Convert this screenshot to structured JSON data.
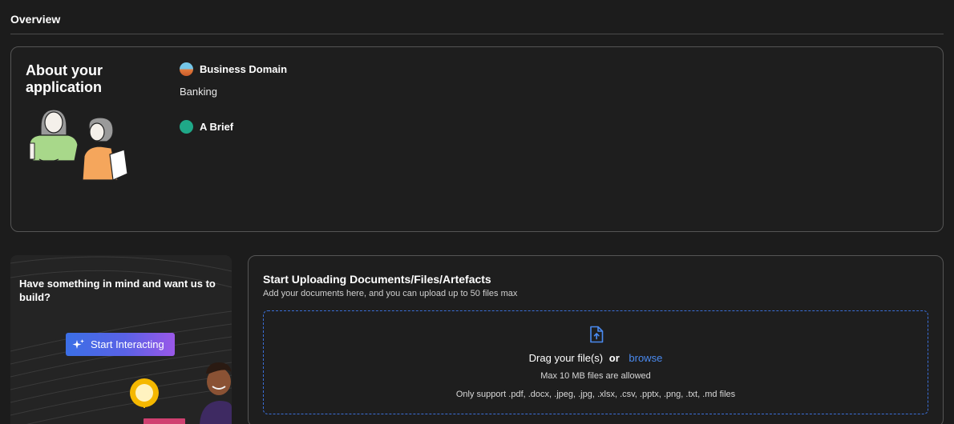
{
  "overview": {
    "title": "Overview"
  },
  "about": {
    "title": "About your application",
    "business_domain_label": "Business Domain",
    "business_domain_value": "Banking",
    "brief_label": "A Brief"
  },
  "promo": {
    "text": "Have something in mind and want us to build?",
    "button_label": "Start Interacting"
  },
  "upload": {
    "title": "Start Uploading Documents/Files/Artefacts",
    "subtitle": "Add your documents here, and you can upload up to 50 files max",
    "drag_text": "Drag your file(s)",
    "or_text": "or",
    "browse_text": "browse",
    "max_size_text": "Max 10 MB files are allowed",
    "support_text": "Only support .pdf, .docx, .jpeg, .jpg, .xlsx, .csv, .pptx, .png, .txt, .md files"
  },
  "colors": {
    "background": "#1c1c1c",
    "card_border": "#555555",
    "accent_blue": "#4a8af0",
    "button_gradient_start": "#3b6fe6",
    "button_gradient_end": "#9a58e8"
  },
  "icons": {
    "domain": "domain-globe-icon",
    "brief": "brief-icon",
    "sparkle": "sparkle-icon",
    "file_upload": "file-upload-icon"
  }
}
